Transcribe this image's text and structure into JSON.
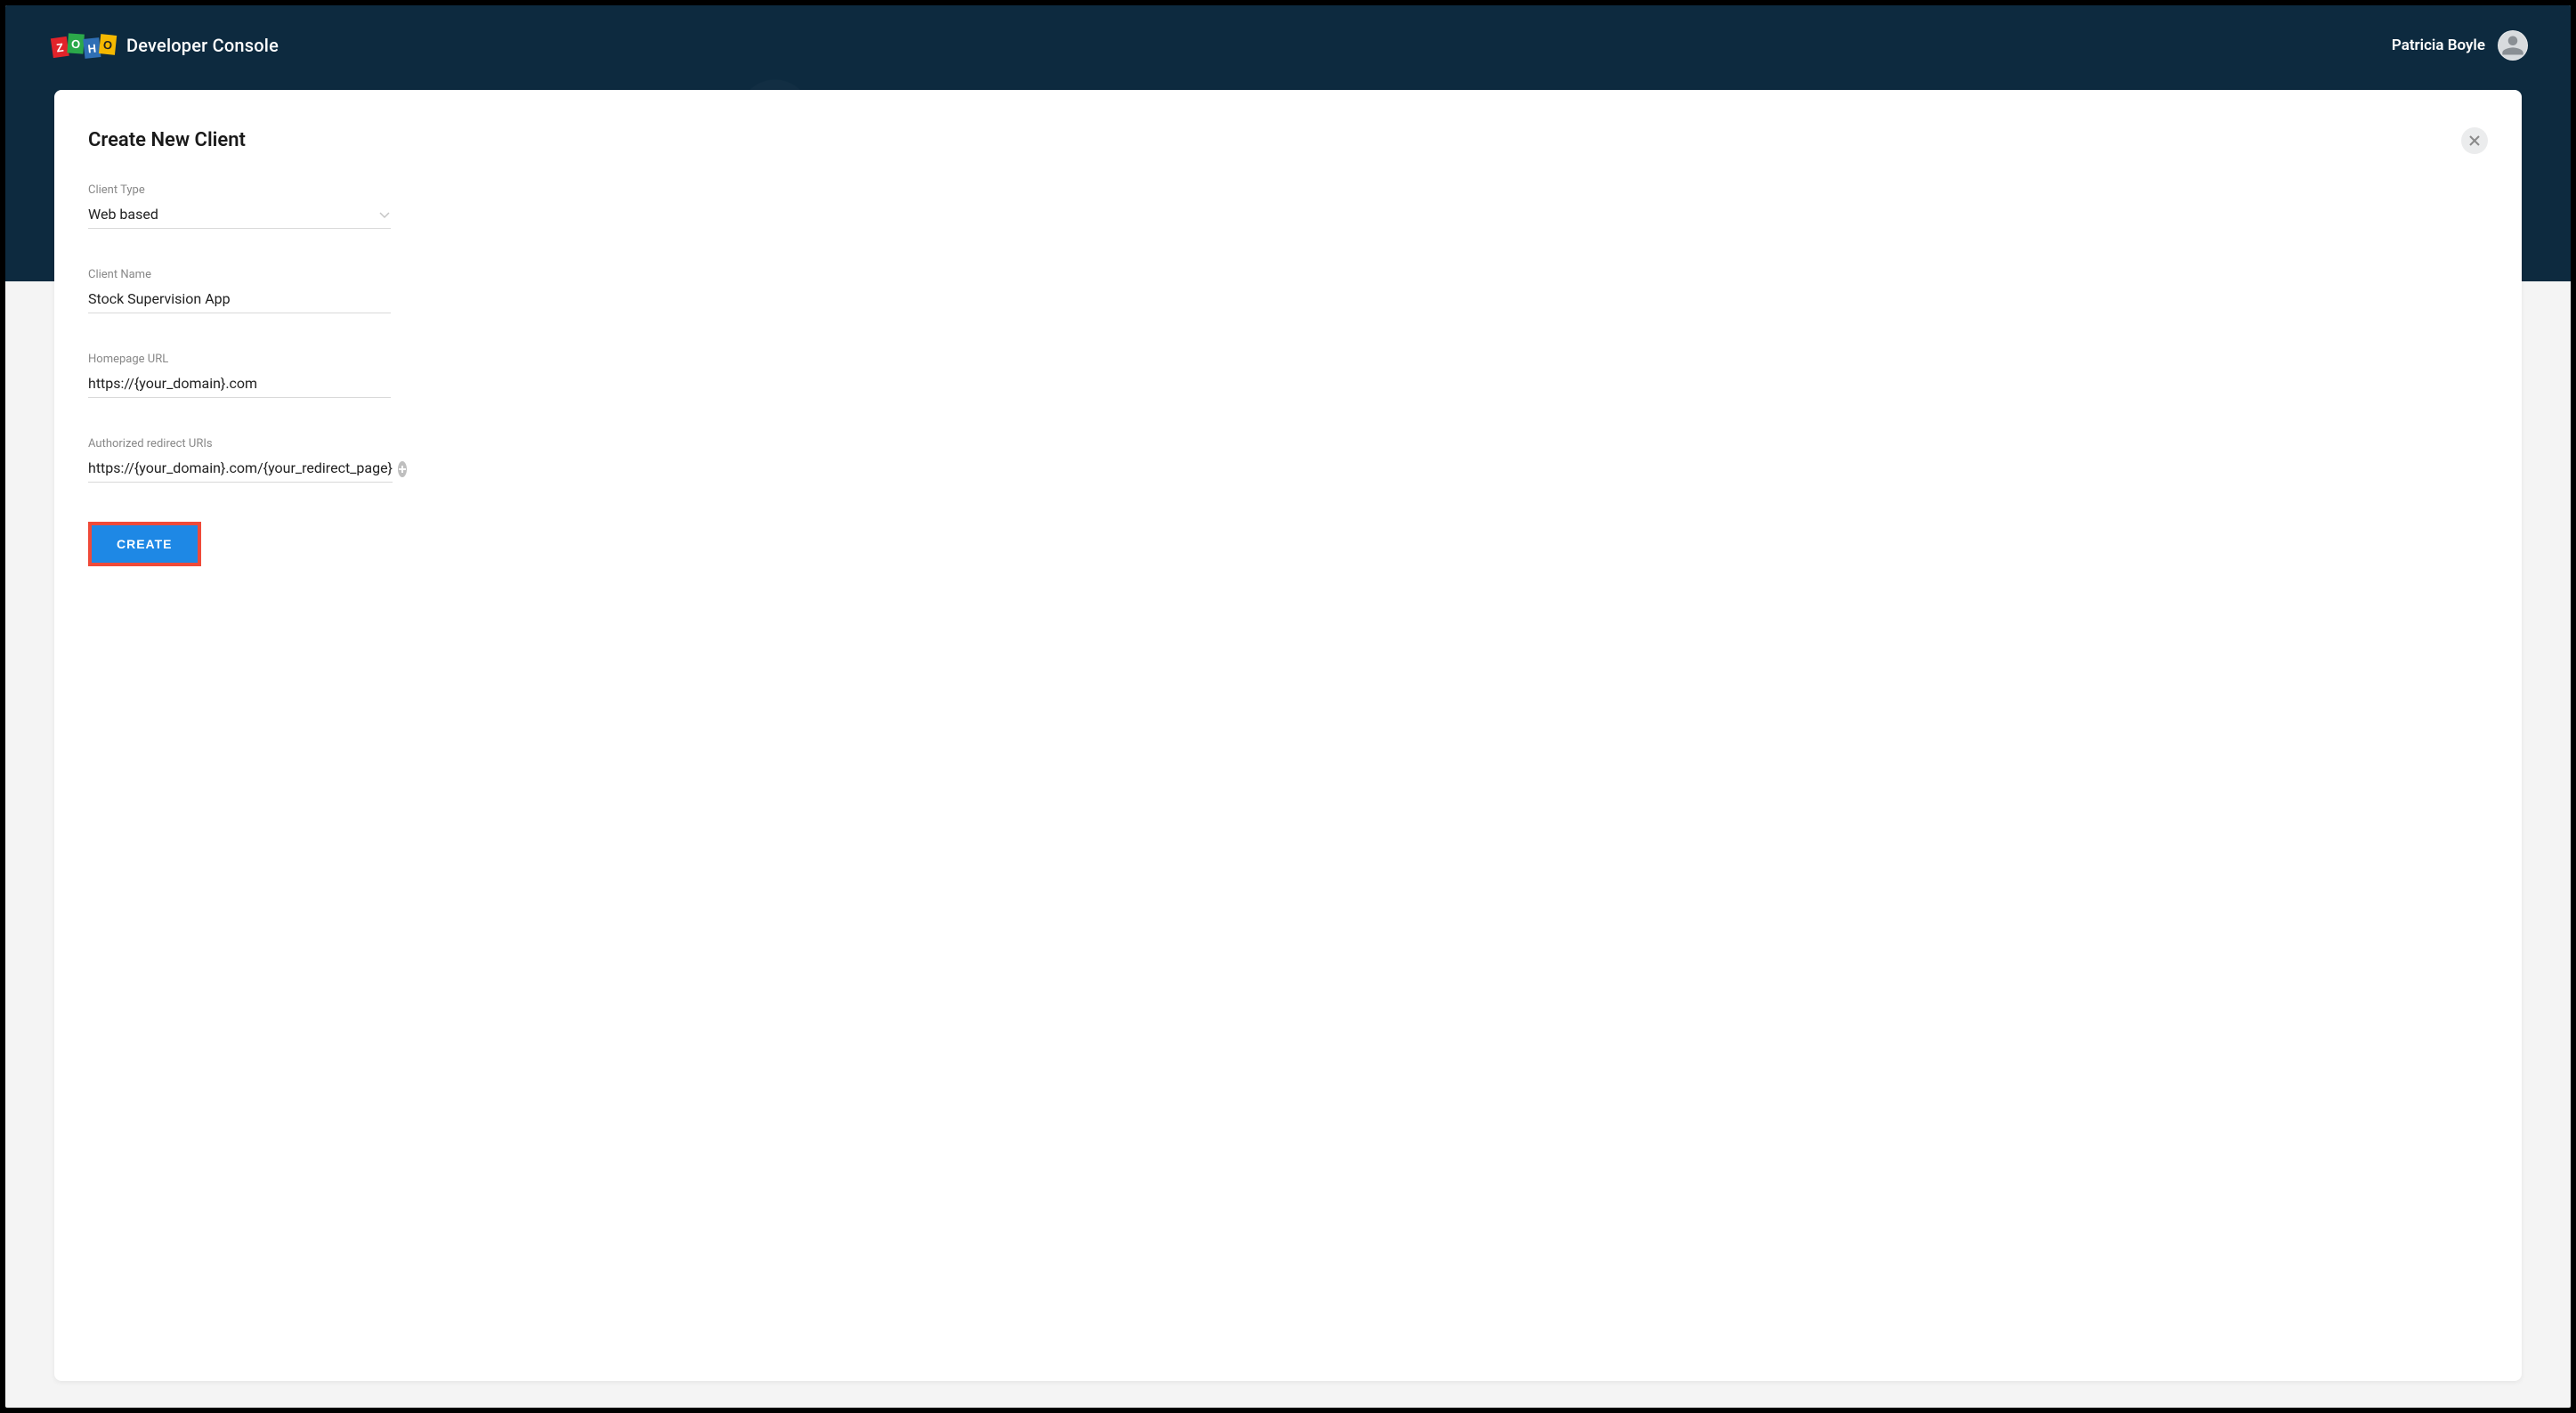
{
  "brand": {
    "logo_letters": [
      "Z",
      "O",
      "H",
      "O"
    ],
    "app_title": "Developer Console"
  },
  "user": {
    "name": "Patricia Boyle"
  },
  "card": {
    "title": "Create New Client",
    "fields": {
      "client_type": {
        "label": "Client Type",
        "value": "Web based"
      },
      "client_name": {
        "label": "Client Name",
        "value": "Stock Supervision App"
      },
      "homepage_url": {
        "label": "Homepage URL",
        "value": "https://{your_domain}.com"
      },
      "redirect_uris": {
        "label": "Authorized redirect URIs",
        "value": "https://{your_domain}.com/{your_redirect_page}"
      }
    },
    "create_button": "CREATE"
  }
}
